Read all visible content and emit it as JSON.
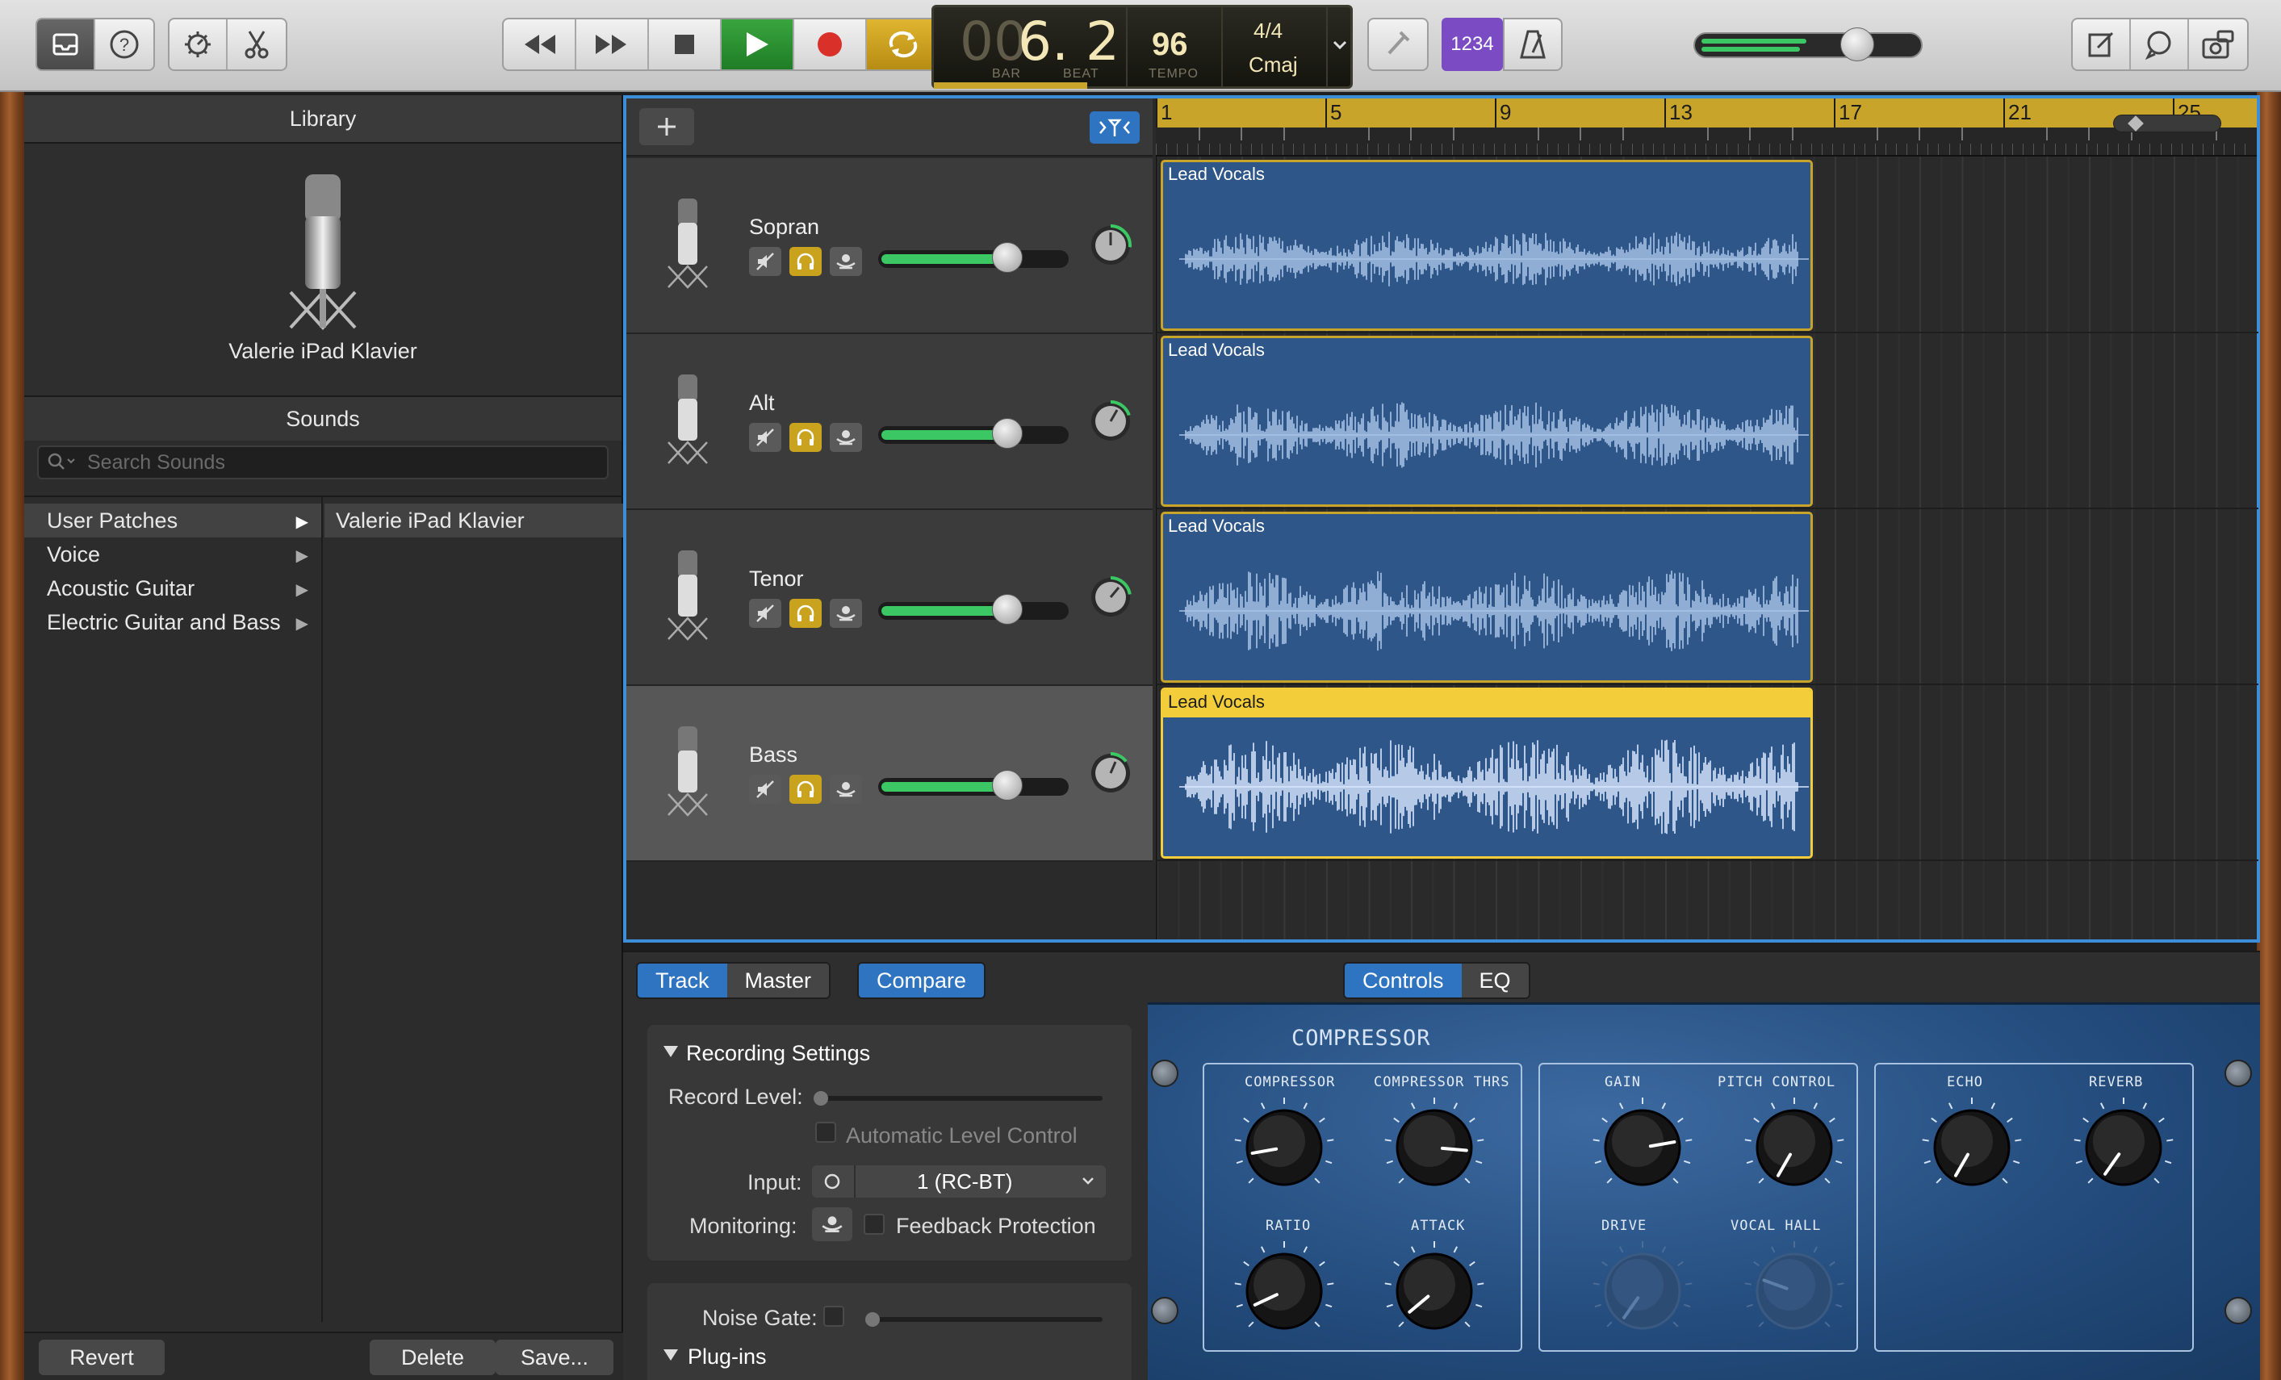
{
  "toolbar": {
    "left_icons": [
      "inbox-icon",
      "help-icon",
      "smart-controls-icon",
      "scissors-icon"
    ],
    "transport": [
      "rewind-icon",
      "fast-forward-icon",
      "stop-icon",
      "play-icon",
      "record-icon",
      "cycle-icon"
    ],
    "lcd": {
      "bar_prefix": "00",
      "position": "6. 2",
      "bar_label": "BAR",
      "beat_label": "BEAT",
      "tempo": "96",
      "tempo_label": "TEMPO",
      "time_signature": "4/4",
      "key": "Cmaj"
    },
    "count_in": "1234",
    "master_volume": 0.66,
    "right_icons": [
      "notepad-icon",
      "loop-browser-icon",
      "media-browser-icon"
    ]
  },
  "library": {
    "title": "Library",
    "patch_name": "Valerie iPad Klavier",
    "sounds_title": "Sounds",
    "search_placeholder": "Search Sounds",
    "categories": [
      {
        "label": "User Patches",
        "selected": true
      },
      {
        "label": "Voice",
        "selected": false
      },
      {
        "label": "Acoustic Guitar",
        "selected": false
      },
      {
        "label": "Electric Guitar and Bass",
        "selected": false
      }
    ],
    "patches": [
      "Valerie iPad Klavier"
    ],
    "revert": "Revert",
    "delete": "Delete",
    "save": "Save..."
  },
  "tracks": [
    {
      "name": "Sopran",
      "volume": 0.68,
      "selected": false
    },
    {
      "name": "Alt",
      "volume": 0.68,
      "selected": false
    },
    {
      "name": "Tenor",
      "volume": 0.68,
      "selected": false
    },
    {
      "name": "Bass",
      "volume": 0.68,
      "selected": true
    }
  ],
  "ruler": {
    "bars": [
      "1",
      "5",
      "9",
      "13",
      "17",
      "21",
      "25"
    ]
  },
  "regions": [
    {
      "label": "Lead Vocals"
    },
    {
      "label": "Lead Vocals"
    },
    {
      "label": "Lead Vocals"
    },
    {
      "label": "Lead Vocals"
    }
  ],
  "bottom": {
    "tabs": {
      "track": "Track",
      "master": "Master",
      "compare": "Compare"
    },
    "view_tabs": {
      "controls": "Controls",
      "eq": "EQ"
    },
    "recording_settings": "Recording Settings",
    "record_level": "Record Level:",
    "auto_level": "Automatic Level Control",
    "input_label": "Input:",
    "input_value": "1  (RC-BT)",
    "monitoring_label": "Monitoring:",
    "feedback": "Feedback Protection",
    "noise_gate": "Noise Gate:",
    "plugins": "Plug-ins"
  },
  "compressor": {
    "title": "COMPRESSOR",
    "knobs": [
      "COMPRESSOR",
      "COMPRESSOR THRS",
      "GAIN",
      "PITCH CONTROL",
      "ECHO",
      "REVERB",
      "RATIO",
      "ATTACK",
      "DRIVE",
      "VOCAL HALL"
    ]
  }
}
